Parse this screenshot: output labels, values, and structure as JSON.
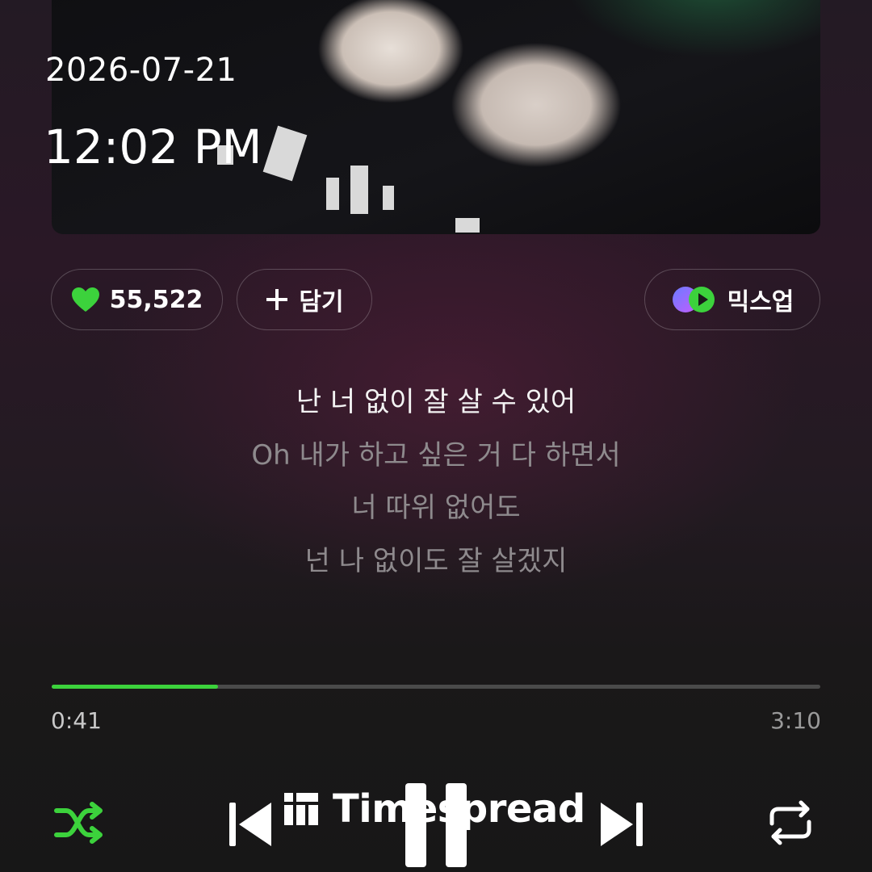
{
  "status": {
    "date": "2026-07-21",
    "time": "12:02 PM"
  },
  "actions": {
    "like_count": "55,522",
    "add_label": "담기",
    "mixup_label": "믹스업"
  },
  "lyrics": [
    "난 너 없이 잘 살 수 있어",
    "Oh 내가 하고 싶은 거 다 하면서",
    "너 따위 없어도",
    "넌 나 없이도 잘 살겠지"
  ],
  "player": {
    "elapsed": "0:41",
    "total": "3:10",
    "progress_fraction": 0.216,
    "accent_color": "#3cd23c"
  },
  "controls": [
    "shuffle-icon",
    "previous-icon",
    "pause-icon",
    "next-icon",
    "repeat-icon"
  ],
  "watermark": {
    "text": "Timespread"
  }
}
